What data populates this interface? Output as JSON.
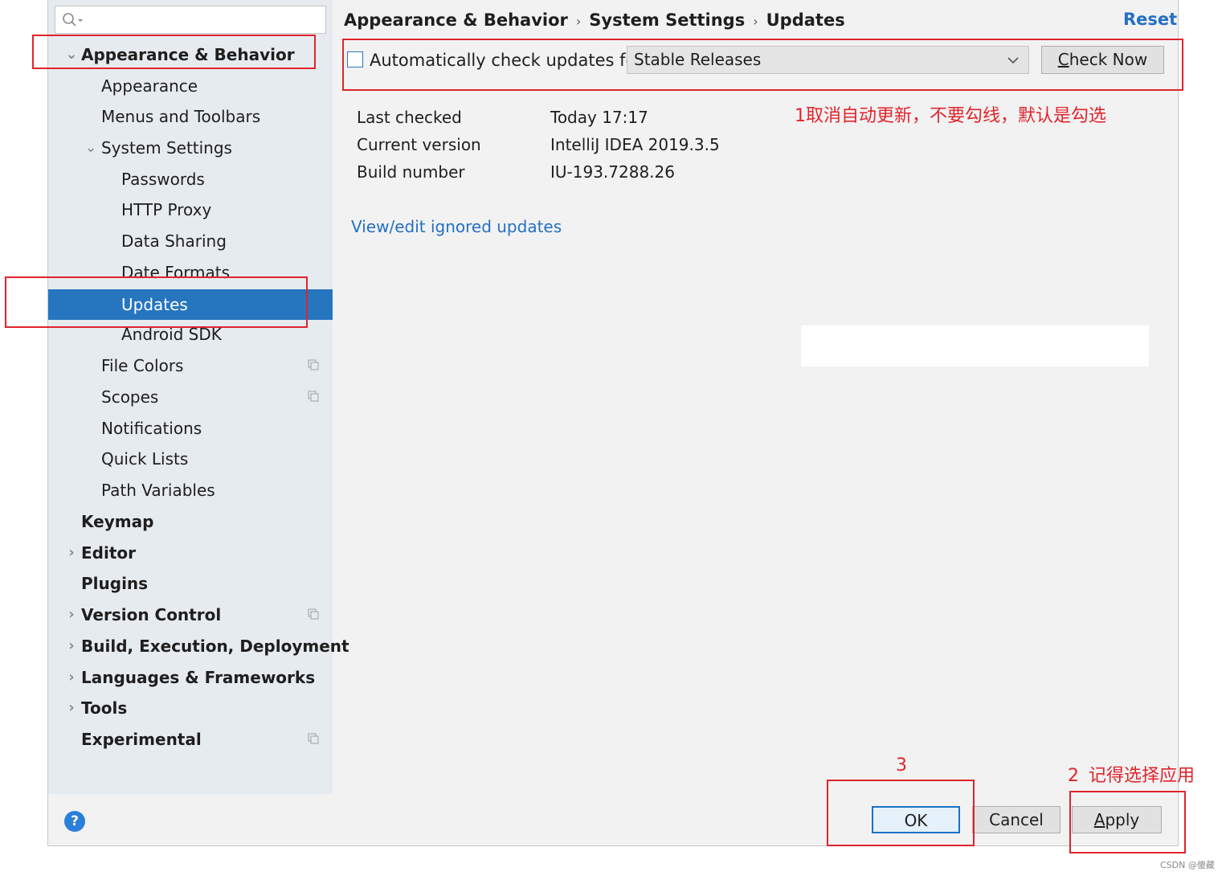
{
  "sidebar": {
    "search_placeholder": "",
    "items": [
      {
        "label": "Appearance & Behavior"
      },
      {
        "label": "Appearance"
      },
      {
        "label": "Menus and Toolbars"
      },
      {
        "label": "System Settings"
      },
      {
        "label": "Passwords"
      },
      {
        "label": "HTTP Proxy"
      },
      {
        "label": "Data Sharing"
      },
      {
        "label": "Date Formats"
      },
      {
        "label": "Updates"
      },
      {
        "label": "Android SDK"
      },
      {
        "label": "File Colors"
      },
      {
        "label": "Scopes"
      },
      {
        "label": "Notifications"
      },
      {
        "label": "Quick Lists"
      },
      {
        "label": "Path Variables"
      },
      {
        "label": "Keymap"
      },
      {
        "label": "Editor"
      },
      {
        "label": "Plugins"
      },
      {
        "label": "Version Control"
      },
      {
        "label": "Build, Execution, Deployment"
      },
      {
        "label": "Languages & Frameworks"
      },
      {
        "label": "Tools"
      },
      {
        "label": "Experimental"
      }
    ]
  },
  "breadcrumb": {
    "part1": "Appearance & Behavior",
    "part2": "System Settings",
    "part3": "Updates",
    "separator": "›"
  },
  "reset_label": "Reset",
  "updates": {
    "auto_check_label": "Automatically check updates for",
    "auto_check_checked": false,
    "channel_value": "Stable Releases",
    "check_now_prefix": "C",
    "check_now_rest": "heck Now",
    "rows": [
      {
        "key": "Last checked",
        "value": "Today 17:17"
      },
      {
        "key": "Current version",
        "value": "IntelliJ IDEA 2019.3.5"
      },
      {
        "key": "Build number",
        "value": "IU-193.7288.26"
      }
    ],
    "ignored_link": "View/edit ignored updates"
  },
  "footer": {
    "help": "?",
    "ok": "OK",
    "cancel": "Cancel",
    "apply_prefix": "A",
    "apply_rest": "pply"
  },
  "annotations": {
    "note1": "1取消自动更新，不要勾线，默认是勾选",
    "note2_num": "2",
    "note2_text": "记得选择应用",
    "note3": "3"
  },
  "watermark": "CSDN @傻藏",
  "colors": {
    "selection": "#2675bf",
    "link": "#2470c2",
    "annotation": "#e0242c",
    "sidebar_bg": "#e6ebf0"
  }
}
